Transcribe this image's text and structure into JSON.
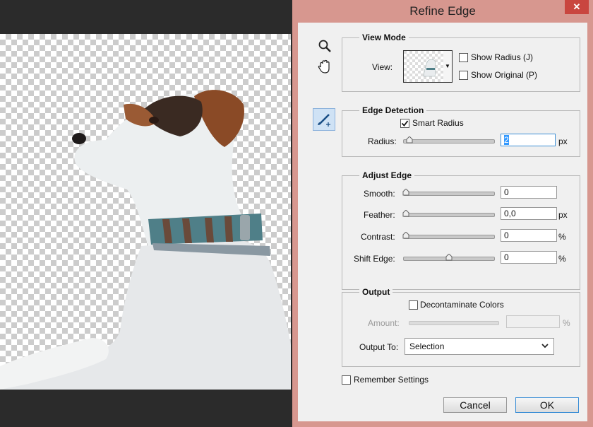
{
  "dialog": {
    "title": "Refine Edge",
    "close_symbol": "✕"
  },
  "tools": [
    "zoom-icon",
    "hand-icon",
    "refine-radius-brush-icon"
  ],
  "view_mode": {
    "legend": "View Mode",
    "view_label": "View:",
    "show_radius": {
      "label": "Show Radius (J)",
      "checked": false
    },
    "show_original": {
      "label": "Show Original (P)",
      "checked": false
    }
  },
  "edge_detection": {
    "legend": "Edge Detection",
    "smart_radius": {
      "label": "Smart Radius",
      "checked": true
    },
    "radius_label": "Radius:",
    "radius_value": "2",
    "radius_unit": "px",
    "radius_slider_fraction": 0.05
  },
  "adjust_edge": {
    "legend": "Adjust Edge",
    "smooth": {
      "label": "Smooth:",
      "value": "0",
      "unit": "",
      "slider_fraction": 0.0
    },
    "feather": {
      "label": "Feather:",
      "value": "0,0",
      "unit": "px",
      "slider_fraction": 0.0
    },
    "contrast": {
      "label": "Contrast:",
      "value": "0",
      "unit": "%",
      "slider_fraction": 0.0
    },
    "shift_edge": {
      "label": "Shift Edge:",
      "value": "0",
      "unit": "%",
      "slider_fraction": 0.5
    }
  },
  "output": {
    "legend": "Output",
    "decontaminate": {
      "label": "Decontaminate Colors",
      "checked": false
    },
    "amount_label": "Amount:",
    "amount_unit": "%",
    "output_to_label": "Output To:",
    "output_to_value": "Selection"
  },
  "remember_settings": {
    "label": "Remember Settings",
    "checked": false
  },
  "buttons": {
    "cancel": "Cancel",
    "ok": "OK"
  }
}
